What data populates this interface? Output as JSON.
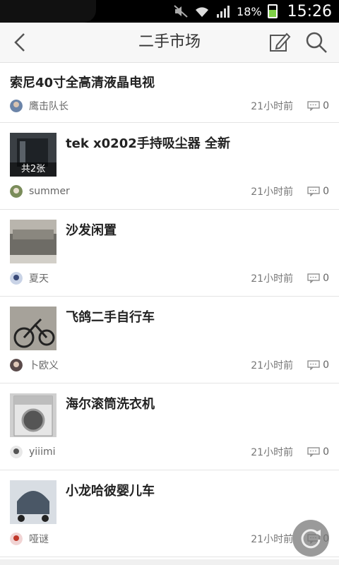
{
  "status_bar": {
    "battery": "18%",
    "time": "15:26"
  },
  "nav": {
    "title": "二手市场"
  },
  "items": [
    {
      "title": "索尼40寸全高清液晶电视",
      "author": "鹰击队长",
      "time": "21小时前",
      "comments": "0"
    },
    {
      "title": "tek x0202手持吸尘器 全新",
      "author": "summer",
      "time": "21小时前",
      "comments": "0",
      "badge": "共2张"
    },
    {
      "title": "沙发闲置",
      "author": "夏天",
      "time": "21小时前",
      "comments": "0"
    },
    {
      "title": "飞鸽二手自行车",
      "author": "卜欧义",
      "time": "21小时前",
      "comments": "0"
    },
    {
      "title": "海尔滚筒洗衣机",
      "author": "yiiimi",
      "time": "21小时前",
      "comments": "0"
    },
    {
      "title": "小龙哈彼婴儿车",
      "author": "哑谜",
      "time": "21小时前",
      "comments": "0"
    }
  ]
}
